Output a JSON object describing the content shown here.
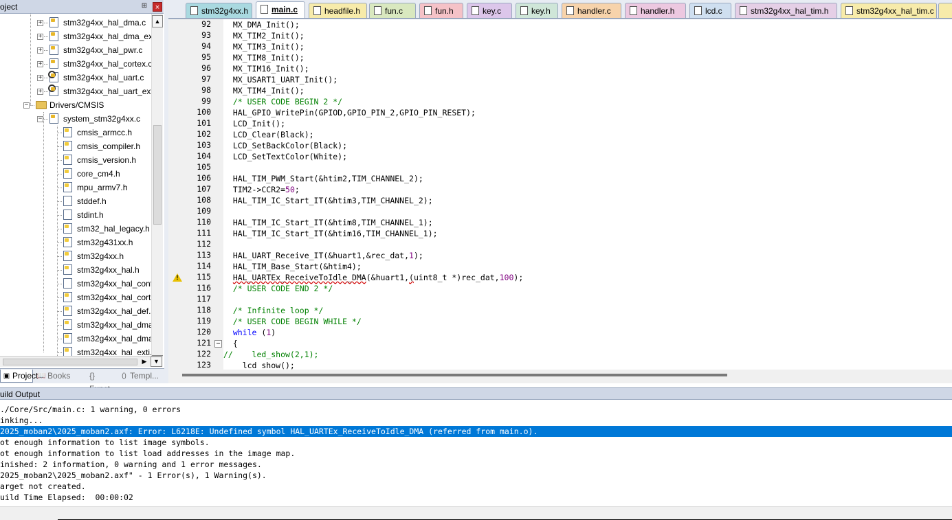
{
  "project_panel": {
    "title": "oject",
    "pin_glyph": "⊞",
    "close_glyph": "×",
    "tree": [
      {
        "label": "stm32g4xx_hal_dma.c",
        "icon": "c-file-icon"
      },
      {
        "label": "stm32g4xx_hal_dma_ex.",
        "icon": "c-file-icon"
      },
      {
        "label": "stm32g4xx_hal_pwr.c",
        "icon": "c-file-icon"
      },
      {
        "label": "stm32g4xx_hal_cortex.c",
        "icon": "c-file-icon"
      },
      {
        "label": "stm32g4xx_hal_uart.c",
        "icon": "c-file-gear-icon"
      },
      {
        "label": "stm32g4xx_hal_uart_ex.c",
        "icon": "c-file-gear-icon"
      },
      {
        "label": "Drivers/CMSIS",
        "icon": "folder-icon"
      },
      {
        "label": "system_stm32g4xx.c",
        "icon": "c-file-icon"
      },
      {
        "label": "cmsis_armcc.h",
        "icon": "header-file-icon"
      },
      {
        "label": "cmsis_compiler.h",
        "icon": "header-file-icon"
      },
      {
        "label": "cmsis_version.h",
        "icon": "header-file-icon"
      },
      {
        "label": "core_cm4.h",
        "icon": "header-file-icon"
      },
      {
        "label": "mpu_armv7.h",
        "icon": "header-file-icon"
      },
      {
        "label": "stddef.h",
        "icon": "plain-file-icon"
      },
      {
        "label": "stdint.h",
        "icon": "plain-file-icon"
      },
      {
        "label": "stm32_hal_legacy.h",
        "icon": "header-file-icon"
      },
      {
        "label": "stm32g431xx.h",
        "icon": "header-file-icon"
      },
      {
        "label": "stm32g4xx.h",
        "icon": "header-file-icon"
      },
      {
        "label": "stm32g4xx_hal.h",
        "icon": "header-file-icon"
      },
      {
        "label": "stm32g4xx_hal_conf",
        "icon": "plain-file-icon"
      },
      {
        "label": "stm32g4xx_hal_corte",
        "icon": "header-file-icon"
      },
      {
        "label": "stm32g4xx_hal_def.h",
        "icon": "header-file-icon"
      },
      {
        "label": "stm32g4xx_hal_dma",
        "icon": "header-file-icon"
      },
      {
        "label": "stm32g4xx_hal_dma",
        "icon": "header-file-icon"
      },
      {
        "label": "stm32g4xx_hal_exti.",
        "icon": "header-file-icon"
      }
    ],
    "tabs": [
      {
        "label": "Project",
        "icon": "project-icon"
      },
      {
        "label": "Books",
        "icon": "books-icon"
      },
      {
        "label": "{} Funct...",
        "icon": "functions-icon"
      },
      {
        "label": "Templ...",
        "icon": "templates-icon"
      }
    ]
  },
  "editor": {
    "tabs": [
      {
        "label": "stm32g4xx.h",
        "color": "#a9d9e0"
      },
      {
        "label": "main.c",
        "color": "#ffffff"
      },
      {
        "label": "headfile.h",
        "color": "#f7ebaa"
      },
      {
        "label": "fun.c",
        "color": "#d9e8bf"
      },
      {
        "label": "fun.h",
        "color": "#f5c2c7"
      },
      {
        "label": "key.c",
        "color": "#dcc6ea"
      },
      {
        "label": "key.h",
        "color": "#cfe6d8"
      },
      {
        "label": "handler.c",
        "color": "#f7d3ab"
      },
      {
        "label": "handler.h",
        "color": "#ecc8e0"
      },
      {
        "label": "lcd.c",
        "color": "#cfdff0"
      },
      {
        "label": "stm32g4xx_hal_tim.h",
        "color": "#e5cfe6"
      },
      {
        "label": "stm32g4xx_hal_tim.c",
        "color": "#f7ebaa"
      }
    ],
    "lines": [
      {
        "n": "92",
        "parts": [
          {
            "t": "  MX_DMA_Init();",
            "c": ""
          }
        ]
      },
      {
        "n": "93",
        "parts": [
          {
            "t": "  MX_TIM2_Init();",
            "c": ""
          }
        ]
      },
      {
        "n": "94",
        "parts": [
          {
            "t": "  MX_TIM3_Init();",
            "c": ""
          }
        ]
      },
      {
        "n": "95",
        "parts": [
          {
            "t": "  MX_TIM8_Init();",
            "c": ""
          }
        ]
      },
      {
        "n": "96",
        "parts": [
          {
            "t": "  MX_TIM16_Init();",
            "c": ""
          }
        ]
      },
      {
        "n": "97",
        "parts": [
          {
            "t": "  MX_USART1_UART_Init();",
            "c": ""
          }
        ]
      },
      {
        "n": "98",
        "parts": [
          {
            "t": "  MX_TIM4_Init();",
            "c": ""
          }
        ]
      },
      {
        "n": "99",
        "parts": [
          {
            "t": "  /* USER CODE BEGIN 2 */",
            "c": "cmt"
          }
        ]
      },
      {
        "n": "100",
        "parts": [
          {
            "t": "  HAL_GPIO_WritePin(GPIOD,GPIO_PIN_2,GPIO_PIN_RESET);",
            "c": ""
          }
        ]
      },
      {
        "n": "101",
        "parts": [
          {
            "t": "  LCD_Init();",
            "c": ""
          }
        ]
      },
      {
        "n": "102",
        "parts": [
          {
            "t": "  LCD_Clear(Black);",
            "c": ""
          }
        ]
      },
      {
        "n": "103",
        "parts": [
          {
            "t": "  LCD_SetBackColor(Black);",
            "c": ""
          }
        ]
      },
      {
        "n": "104",
        "parts": [
          {
            "t": "  LCD_SetTextColor(White);",
            "c": ""
          }
        ]
      },
      {
        "n": "105",
        "parts": []
      },
      {
        "n": "106",
        "parts": [
          {
            "t": "  HAL_TIM_PWM_Start(&htim2,TIM_CHANNEL_2);",
            "c": ""
          }
        ]
      },
      {
        "n": "107",
        "parts": [
          {
            "t": "  TIM2->CCR2=",
            "c": ""
          },
          {
            "t": "50",
            "c": "num"
          },
          {
            "t": ";",
            "c": ""
          }
        ]
      },
      {
        "n": "108",
        "parts": [
          {
            "t": "  HAL_TIM_IC_Start_IT(&htim3,TIM_CHANNEL_2);",
            "c": ""
          }
        ]
      },
      {
        "n": "109",
        "parts": []
      },
      {
        "n": "110",
        "parts": [
          {
            "t": "  HAL_TIM_IC_Start_IT(&htim8,TIM_CHANNEL_1);",
            "c": ""
          }
        ]
      },
      {
        "n": "111",
        "parts": [
          {
            "t": "  HAL_TIM_IC_Start_IT(&htim16,TIM_CHANNEL_1);",
            "c": ""
          }
        ]
      },
      {
        "n": "112",
        "parts": []
      },
      {
        "n": "113",
        "parts": [
          {
            "t": "  HAL_UART_Receive_IT(&huart1,&rec_dat,",
            "c": ""
          },
          {
            "t": "1",
            "c": "num"
          },
          {
            "t": ");",
            "c": ""
          }
        ]
      },
      {
        "n": "114",
        "parts": [
          {
            "t": "  HAL_TIM_Base_Start(&htim4);",
            "c": ""
          }
        ]
      },
      {
        "n": "115",
        "parts": [
          {
            "t": "  ",
            "c": ""
          },
          {
            "t": "HAL_UARTEx_ReceiveToIdle_DMA",
            "c": "squig"
          },
          {
            "t": "(&huart1,",
            "c": ""
          },
          {
            "t": "(",
            "c": "squig"
          },
          {
            "t": "uint8_t *)rec_dat,",
            "c": ""
          },
          {
            "t": "100",
            "c": "num"
          },
          {
            "t": ");",
            "c": ""
          }
        ]
      },
      {
        "n": "116",
        "parts": [
          {
            "t": "  /* USER CODE END 2 */",
            "c": "cmt"
          }
        ]
      },
      {
        "n": "117",
        "parts": []
      },
      {
        "n": "118",
        "parts": [
          {
            "t": "  /* Infinite loop */",
            "c": "cmt"
          }
        ]
      },
      {
        "n": "119",
        "parts": [
          {
            "t": "  /* USER CODE BEGIN WHILE */",
            "c": "cmt"
          }
        ]
      },
      {
        "n": "120",
        "parts": [
          {
            "t": "  ",
            "c": ""
          },
          {
            "t": "while",
            "c": "kw"
          },
          {
            "t": " (",
            "c": ""
          },
          {
            "t": "1",
            "c": "num"
          },
          {
            "t": ")",
            "c": ""
          }
        ]
      },
      {
        "n": "121",
        "parts": [
          {
            "t": "  {",
            "c": ""
          }
        ]
      },
      {
        "n": "122",
        "parts": [
          {
            "t": "//    led_show(2,1);",
            "c": "cmt"
          }
        ]
      },
      {
        "n": "123",
        "parts": [
          {
            "t": "    lcd_show();",
            "c": ""
          }
        ]
      }
    ],
    "warning_line": "115",
    "fold_line": "121"
  },
  "build_output": {
    "title": "uild Output",
    "lines": [
      "./Core/Src/main.c: 1 warning, 0 errors",
      "inking...",
      "2025_moban2\\2025_moban2.axf: Error: L6218E: Undefined symbol HAL_UARTEx_ReceiveToIdle_DMA (referred from main.o).",
      "ot enough information to list image symbols.",
      "ot enough information to list load addresses in the image map.",
      "inished: 2 information, 0 warning and 1 error messages.",
      "2025_moban2\\2025_moban2.axf\" - 1 Error(s), 1 Warning(s).",
      "arget not created.",
      "uild Time Elapsed:  00:00:02"
    ],
    "selected_index": 2
  },
  "colors": {
    "selection": "#0078d7",
    "comment": "#008000",
    "keyword": "#0000ff",
    "number": "#800080",
    "warning": "#e8c000"
  }
}
